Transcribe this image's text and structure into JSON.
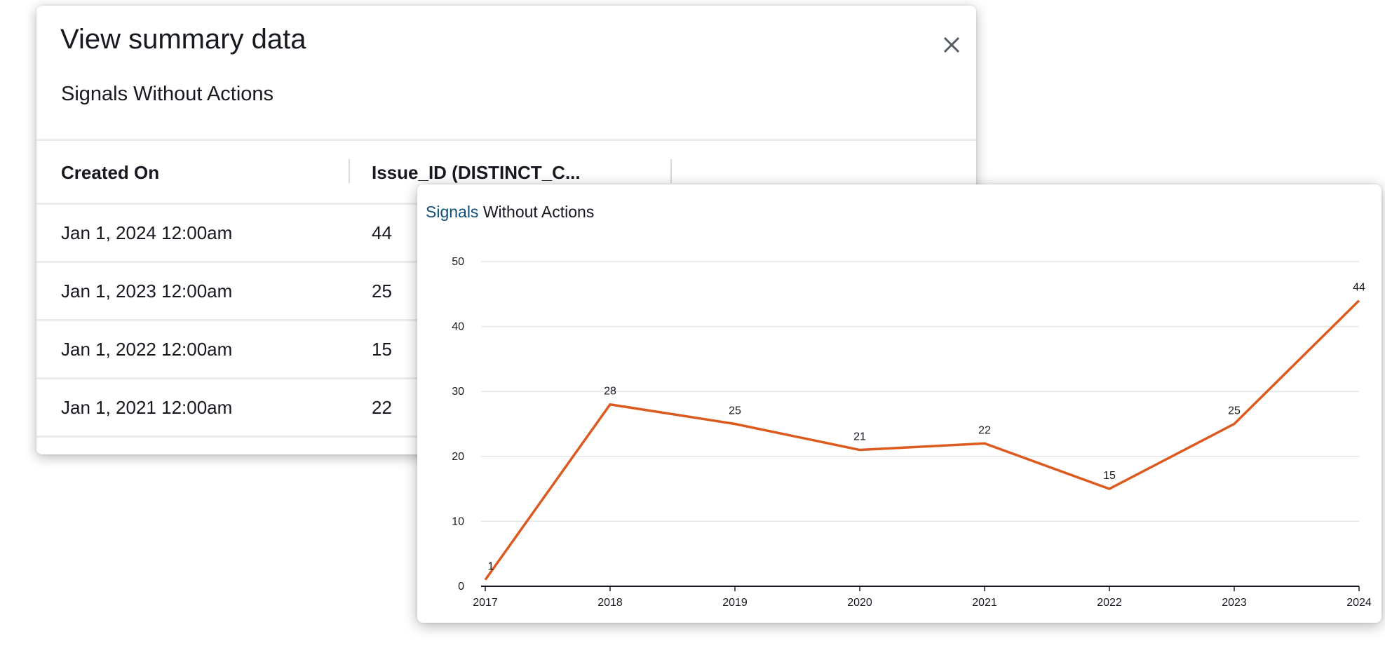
{
  "modal": {
    "title": "View summary data",
    "subtitle": "Signals Without Actions",
    "close_icon": "close-icon",
    "columns": [
      "Created On",
      "Issue_ID (DISTINCT_C..."
    ],
    "rows": [
      {
        "created_on": "Jan 1, 2024 12:00am",
        "value": "44"
      },
      {
        "created_on": "Jan 1, 2023 12:00am",
        "value": "25"
      },
      {
        "created_on": "Jan 1, 2022 12:00am",
        "value": "15"
      },
      {
        "created_on": "Jan 1, 2021 12:00am",
        "value": "22"
      }
    ]
  },
  "chart": {
    "title_part1": "Signals",
    "title_part2": " Without Actions"
  },
  "colors": {
    "line": "#dd5a1f",
    "title_accent": "#0f4f78",
    "grid": "#e4e7ea",
    "axis": "#16191f"
  },
  "chart_data": {
    "type": "line",
    "title": "Signals Without Actions",
    "x": [
      "2017",
      "2018",
      "2019",
      "2020",
      "2021",
      "2022",
      "2023",
      "2024"
    ],
    "series": [
      {
        "values": [
          1,
          28,
          25,
          21,
          22,
          15,
          25,
          44
        ]
      }
    ],
    "ylim": [
      0,
      50
    ],
    "yticks": [
      0,
      10,
      20,
      30,
      40,
      50
    ],
    "grid": true,
    "data_labels": true
  }
}
